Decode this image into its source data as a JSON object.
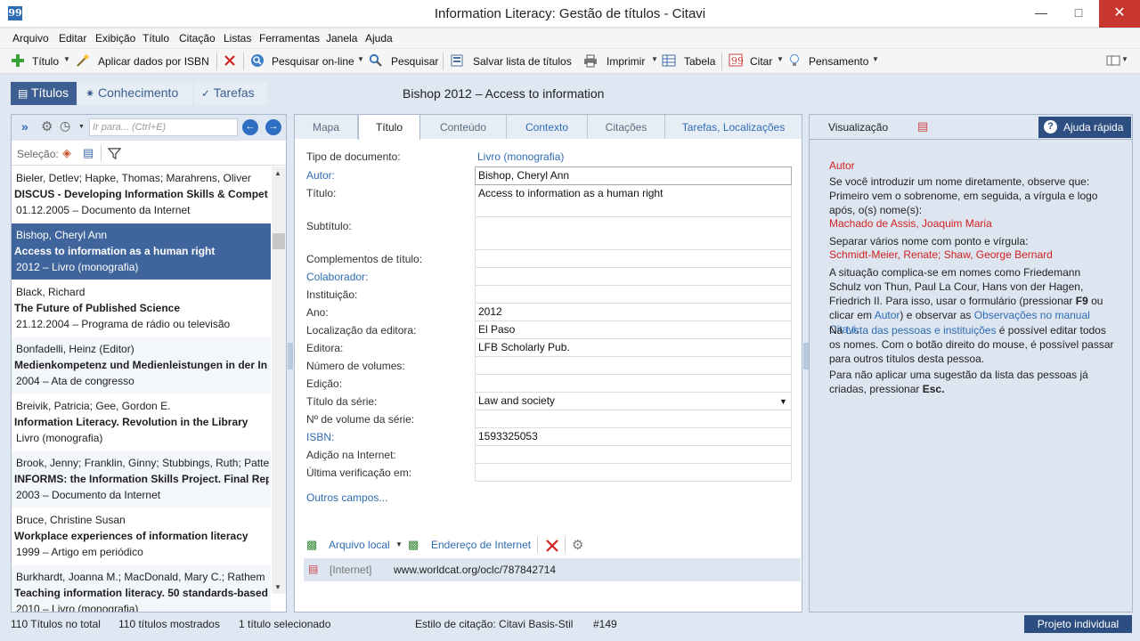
{
  "window": {
    "title": "Information Literacy: Gestão de títulos - Citavi"
  },
  "menu": [
    "Arquivo",
    "Editar",
    "Exibição",
    "Título",
    "Citação",
    "Listas",
    "Ferramentas",
    "Janela",
    "Ajuda"
  ],
  "toolbar": {
    "titulo": "Título",
    "aplicar_isbn": "Aplicar dados por ISBN",
    "pesquisar_online": "Pesquisar on-line",
    "pesquisar": "Pesquisar",
    "salvar_lista": "Salvar lista de títulos",
    "imprimir": "Imprimir",
    "tabela": "Tabela",
    "citar": "Citar",
    "pensamento": "Pensamento"
  },
  "nav": {
    "titulos": "Títulos",
    "conhecimento": "Conhecimento",
    "tarefas": "Tarefas"
  },
  "current_reference": "Bishop 2012 – Access to information",
  "left": {
    "goto_placeholder": "Ir para... (Ctrl+E)",
    "selecao_label": "Seleção:",
    "items": [
      {
        "authors": "Bieler, Detlev; Hapke, Thomas; Marahrens, Oliver",
        "title": "DISCUS - Developing Information Skills & Compet",
        "meta": "01.12.2005 – Documento da Internet"
      },
      {
        "authors": "Bishop, Cheryl Ann",
        "title": "Access to information as a human right",
        "meta": "2012 – Livro (monografia)"
      },
      {
        "authors": "Black, Richard",
        "title": "The Future of Published Science",
        "meta": "21.12.2004 – Programa de rádio ou televisão"
      },
      {
        "authors": "Bonfadelli, Heinz (Editor)",
        "title": "Medienkompetenz und Medienleistungen in der In",
        "meta": "2004 – Ata de congresso"
      },
      {
        "authors": "Breivik, Patricia; Gee, Gordon E.",
        "title": "Information Literacy. Revolution in the Library",
        "meta": "Livro (monografia)"
      },
      {
        "authors": "Brook, Jenny; Franklin, Ginny; Stubbings, Ruth; Patte",
        "title": "INFORMS: the Information Skills Project. Final Rep",
        "meta": "2003 – Documento da Internet"
      },
      {
        "authors": "Bruce, Christine Susan",
        "title": "Workplace experiences of information literacy",
        "meta": "1999 – Artigo em periódico"
      },
      {
        "authors": "Burkhardt, Joanna M.; MacDonald, Mary C.; Rathem",
        "title": "Teaching information literacy. 50 standards-based e",
        "meta": "2010 – Livro (monografia)"
      }
    ]
  },
  "tabs": [
    "Mapa",
    "Título",
    "Conteúdo",
    "Contexto",
    "Citações",
    "Tarefas, Localizações"
  ],
  "fields": {
    "tipo_label": "Tipo de documento:",
    "tipo_value": "Livro (monografia)",
    "autor_label": "Autor:",
    "autor_value": "Bishop, Cheryl Ann",
    "titulo_label": "Título:",
    "titulo_value": "Access to information as a human right",
    "subtitulo_label": "Subtítulo:",
    "complementos_label": "Complementos de título:",
    "colaborador_label": "Colaborador:",
    "instituicao_label": "Instituição:",
    "ano_label": "Ano:",
    "ano_value": "2012",
    "localizacao_label": "Localização da editora:",
    "localizacao_value": "El Paso",
    "editora_label": "Editora:",
    "editora_value": "LFB Scholarly Pub.",
    "numvol_label": "Número de volumes:",
    "edicao_label": "Edição:",
    "serie_label": "Título da série:",
    "serie_value": "Law and society",
    "numserie_label": "Nº de volume da série:",
    "isbn_label": "ISBN:",
    "isbn_value": "1593325053",
    "adicao_label": "Adição na Internet:",
    "ultima_label": "Última verificação em:",
    "outros": "Outros campos..."
  },
  "attachments": {
    "arquivo_local": "Arquivo local",
    "endereco": "Endereço de Internet",
    "row_type": "[Internet]",
    "row_url": "www.worldcat.org/oclc/787842714"
  },
  "right": {
    "visualizacao": "Visualização",
    "ajuda": "Ajuda rápida",
    "heading": "Autor",
    "p1": "Se você introduzir um nome diretamente, observe que: Primeiro vem o sobrenome, em seguida, a vírgula e logo após, o(s) nome(s):",
    "ex1": "Machado de Assis, Joaquim Maria",
    "p2": "Separar vários nome com ponto e vírgula:",
    "ex2": "Schmidt-Meier, Renate; Shaw, George Bernard",
    "p3a": "A situação complica-se em nomes como Friedemann Schulz von Thun, Paul La Cour, Hans von der Hagen, Friedrich II. Para isso, usar o formulário (pressionar ",
    "p3k": "F9",
    "p3b": " ou clicar em ",
    "p3l1": "Autor",
    "p3c": ") e observar as ",
    "p3l2": "Observações no manual Citavi",
    "p3d": ".",
    "p4a": "Na ",
    "p4l": "Lista das pessoas e instituições",
    "p4b": "  é possível editar todos os nomes. Com o botão direito do mouse, é possível passar para outros títulos desta pessoa.",
    "p5a": "Para não aplicar uma sugestão da lista das pessoas já criadas, pressionar ",
    "p5k": "Esc."
  },
  "status": {
    "total": "110 Títulos no total",
    "mostrados": "110 títulos mostrados",
    "selecionado": "1 título selecionado",
    "estilo": "Estilo de citação: Citavi Basis-Stil",
    "numero": "#149",
    "projeto": "Projeto individual"
  },
  "colors": {
    "accent": "#3d5e91",
    "selection": "#40649c",
    "link": "#2e6bb5",
    "hint_red": "#d42020"
  }
}
